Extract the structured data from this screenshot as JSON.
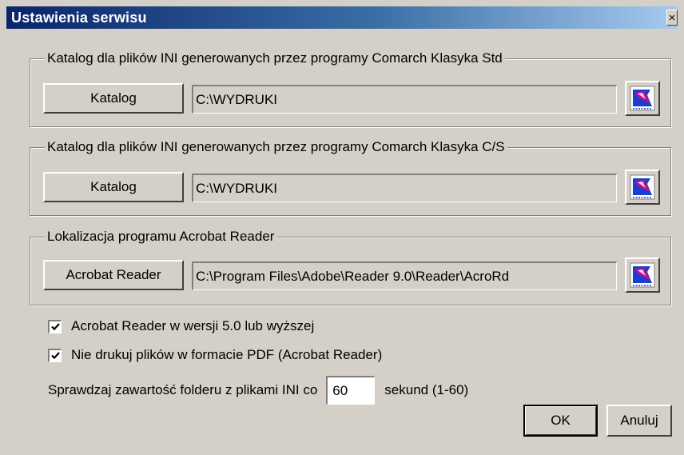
{
  "window": {
    "title": "Ustawienia serwisu",
    "close_label": "×"
  },
  "groups": [
    {
      "legend": "Katalog dla plików INI generowanych przez programy Comarch Klasyka Std",
      "button_label": "Katalog",
      "path": "C:\\WYDRUKI",
      "icon": "directory-browse-icon"
    },
    {
      "legend": "Katalog dla plików INI generowanych przez programy Comarch Klasyka C/S",
      "button_label": "Katalog",
      "path": "C:\\WYDRUKI",
      "icon": "directory-browse-icon"
    },
    {
      "legend": "Lokalizacja programu Acrobat Reader",
      "button_label": "Acrobat Reader",
      "path": "C:\\Program Files\\Adobe\\Reader 9.0\\Reader\\AcroRd",
      "icon": "file-browse-icon"
    }
  ],
  "options": {
    "acrobat_v5": {
      "label": "Acrobat Reader w wersji 5.0 lub wyższej",
      "checked": true
    },
    "no_pdf_print": {
      "label": "Nie drukuj plików w formacie PDF (Acrobat Reader)",
      "checked": true
    }
  },
  "interval": {
    "prefix": "Sprawdzaj zawartość folderu z plikami INI co",
    "value": "60",
    "suffix": "sekund (1-60)"
  },
  "buttons": {
    "ok": "OK",
    "cancel": "Anuluj"
  },
  "colors": {
    "face": "#d4d0c8",
    "title_start": "#0a246a",
    "title_end": "#a6caf0",
    "icon_blue": "#1a3fd0",
    "icon_magenta": "#c0108a"
  }
}
